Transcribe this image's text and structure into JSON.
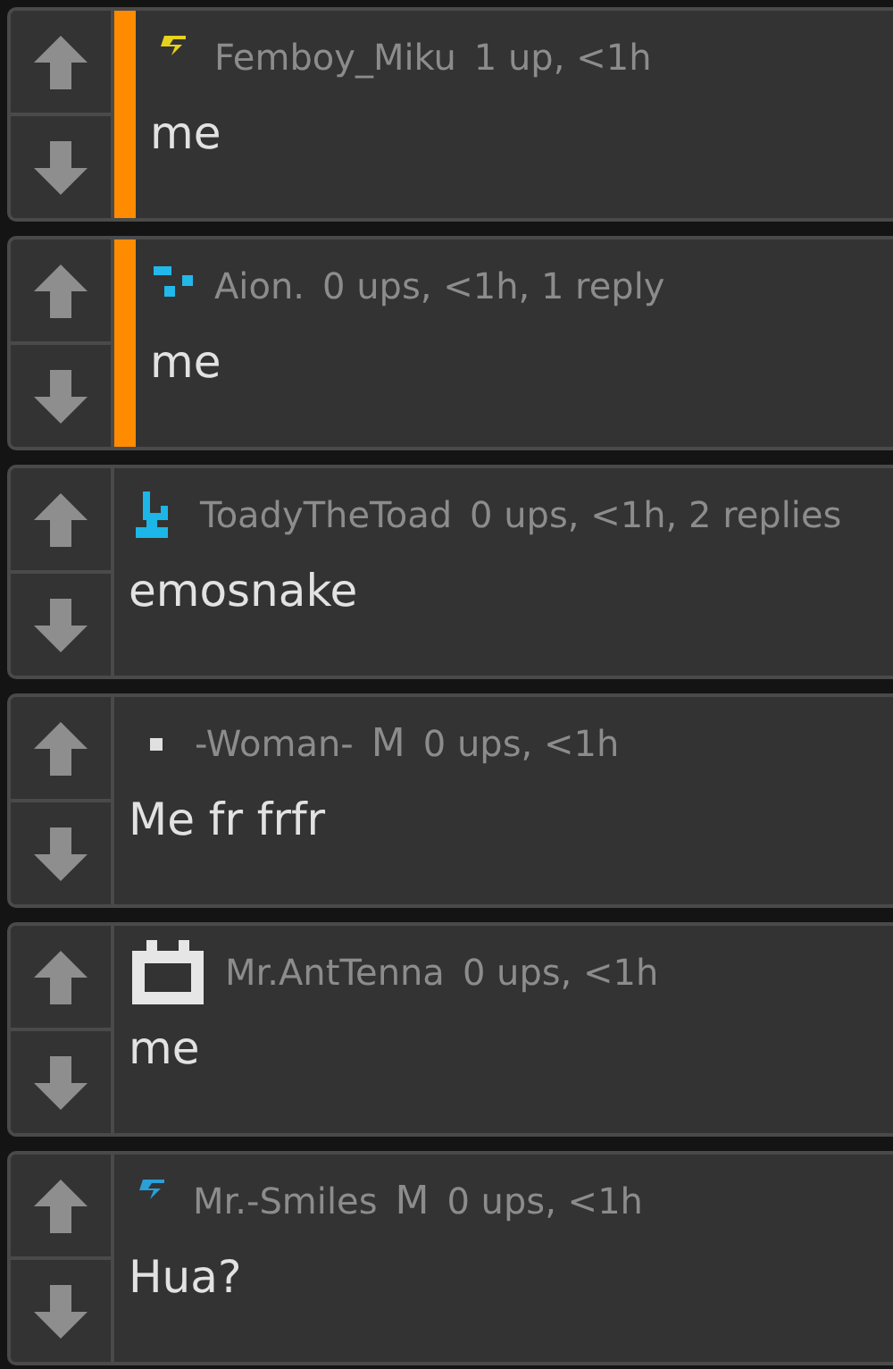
{
  "comments": [
    {
      "user": "Femboy_Miku",
      "meta": "1 up, <1h",
      "text": "me",
      "highlighted": true,
      "avatar": {
        "kind": "bolt",
        "color": "#e8d21a"
      }
    },
    {
      "user": "Aion.",
      "meta": "0 ups, <1h, 1 reply",
      "text": "me",
      "highlighted": true,
      "avatar": {
        "kind": "dots",
        "color": "#22b8ea"
      }
    },
    {
      "user": "ToadyTheToad",
      "meta": "0 ups, <1h, 2 replies",
      "text": "emosnake",
      "highlighted": false,
      "avatar": {
        "kind": "glyph",
        "color": "#1cb6e8"
      }
    },
    {
      "user": "-Woman-",
      "mod_badge": "M",
      "meta": "0 ups, <1h",
      "text": "Me fr frfr",
      "highlighted": false,
      "avatar": {
        "kind": "square",
        "color": "#e0e0e0"
      }
    },
    {
      "user": "Mr.AntTenna",
      "meta": "0 ups, <1h",
      "text": "me",
      "highlighted": false,
      "avatar": {
        "kind": "box",
        "color": "#e6e6e6"
      }
    },
    {
      "user": "Mr.-Smiles",
      "mod_badge": "M",
      "meta": "0 ups, <1h",
      "text": "Hua?",
      "highlighted": false,
      "avatar": {
        "kind": "bolt",
        "color": "#2a9fd8"
      }
    }
  ]
}
